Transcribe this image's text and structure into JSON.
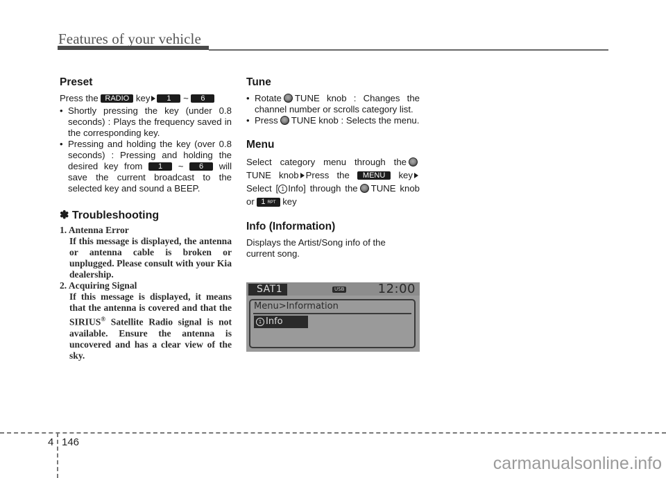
{
  "header": {
    "title": "Features of your vehicle"
  },
  "preset": {
    "heading": "Preset",
    "intro": {
      "press": "Press the",
      "radio_key": "RADIO",
      "key_word": "key",
      "key_1": "1",
      "tilde": "~",
      "key_6": "6"
    },
    "bullet1": "Shortly pressing the key (under 0.8 seconds) : Plays the frequency saved in the corresponding key.",
    "bullet2": {
      "part1": "Pressing and holding the key (over 0.8 seconds) : Pressing and holding the desired key from",
      "key_1": "1",
      "tilde": "~",
      "key_6": "6",
      "part2": "will save the current broadcast to the selected key and sound a BEEP."
    }
  },
  "troubleshooting": {
    "heading": "✽ Troubleshooting",
    "items": [
      {
        "title": "1. Antenna Error",
        "body": "If this message is displayed, the antenna or antenna cable is broken or unplugged. Please consult with your Kia dealership."
      },
      {
        "title": "2. Acquiring Signal",
        "body_a": "If this message is displayed, it means that the antenna is covered and that the SIRIUS",
        "sup": "®",
        "body_b": " Satellite Radio signal is not available. Ensure the antenna is uncovered and has a clear view of the sky."
      }
    ]
  },
  "tune": {
    "heading": "Tune",
    "bullet1": {
      "pre": "Rotate",
      "post": "TUNE knob : Changes the channel number or scrolls category list."
    },
    "bullet2": {
      "pre": "Press",
      "post": "TUNE knob : Selects the menu."
    }
  },
  "menu": {
    "heading": "Menu",
    "t1": "Select category menu through the",
    "t2": "TUNE knob",
    "t3": "Press the",
    "menu_key": "MENU",
    "t4": "key",
    "t5": "Select [",
    "circ": "1",
    "t6": "Info] through the",
    "t7": "TUNE knob",
    "t8": "or",
    "rpt_key_num": "1",
    "rpt_key_sub": "RPT",
    "t9": "key"
  },
  "info": {
    "heading": "Info (Information)",
    "body": "Displays the Artist/Song info of the current song."
  },
  "lcd": {
    "source": "SAT1",
    "usb_badge": "USB",
    "time": "12:00",
    "path": "Menu>Information",
    "item_num": "1",
    "item_label": "Info"
  },
  "footer": {
    "chapter": "4",
    "page": "146",
    "watermark": "carmanualsonline.info"
  }
}
